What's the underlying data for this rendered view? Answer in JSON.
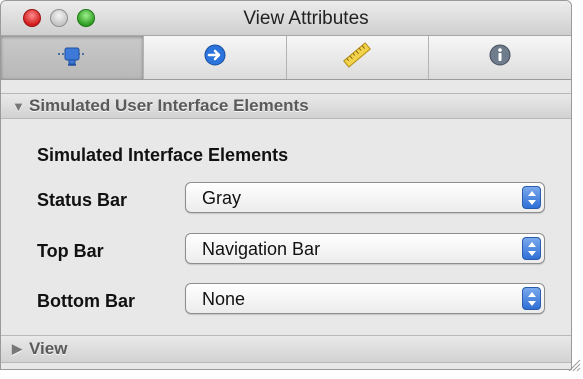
{
  "window": {
    "title": "View Attributes"
  },
  "toolbar": {
    "tabs": [
      {
        "icon": "simulated-elements-icon",
        "selected": true
      },
      {
        "icon": "connections-arrow-icon",
        "selected": false
      },
      {
        "icon": "ruler-icon",
        "selected": false
      },
      {
        "icon": "info-icon",
        "selected": false
      }
    ]
  },
  "sections": {
    "simulated": {
      "header": "Simulated User Interface Elements",
      "expanded": true,
      "subheading": "Simulated Interface Elements",
      "rows": [
        {
          "label": "Status Bar",
          "value": "Gray"
        },
        {
          "label": "Top Bar",
          "value": "Navigation Bar"
        },
        {
          "label": "Bottom Bar",
          "value": "None"
        }
      ]
    },
    "view": {
      "header": "View",
      "expanded": false
    }
  },
  "colors": {
    "accent": "#2f6fd6",
    "close": "#d21c1c",
    "zoom": "#2f9e24"
  }
}
